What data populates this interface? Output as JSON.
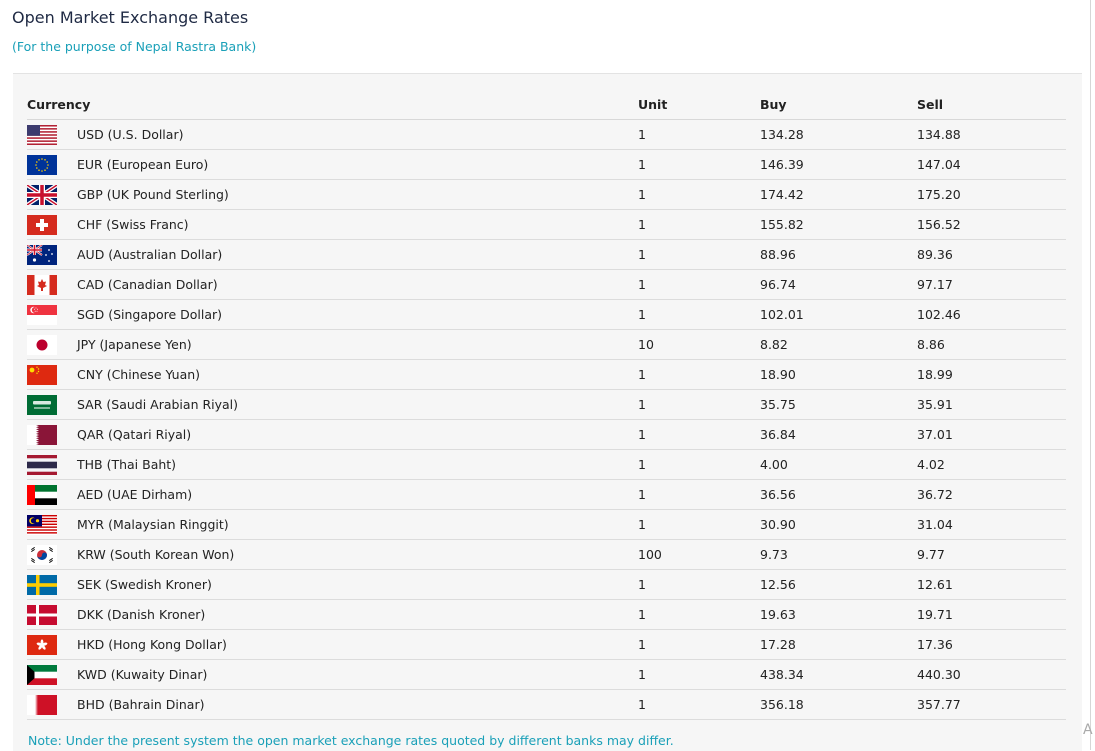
{
  "page": {
    "title": "Open Market Exchange Rates",
    "subtitle": "(For the purpose of Nepal Rastra Bank)",
    "note": "Note: Under the present system the open market exchange rates quoted by different banks may differ.",
    "edge_letter": "A"
  },
  "table": {
    "headers": {
      "currency": "Currency",
      "unit": "Unit",
      "buy": "Buy",
      "sell": "Sell"
    },
    "rows": [
      {
        "flag_icon": "flag-us-icon",
        "currency": "USD (U.S. Dollar)",
        "unit": "1",
        "buy": "134.28",
        "sell": "134.88"
      },
      {
        "flag_icon": "flag-eu-icon",
        "currency": "EUR (European Euro)",
        "unit": "1",
        "buy": "146.39",
        "sell": "147.04"
      },
      {
        "flag_icon": "flag-gb-icon",
        "currency": "GBP (UK Pound Sterling)",
        "unit": "1",
        "buy": "174.42",
        "sell": "175.20"
      },
      {
        "flag_icon": "flag-ch-icon",
        "currency": "CHF (Swiss Franc)",
        "unit": "1",
        "buy": "155.82",
        "sell": "156.52"
      },
      {
        "flag_icon": "flag-au-icon",
        "currency": "AUD (Australian Dollar)",
        "unit": "1",
        "buy": "88.96",
        "sell": "89.36"
      },
      {
        "flag_icon": "flag-ca-icon",
        "currency": "CAD (Canadian Dollar)",
        "unit": "1",
        "buy": "96.74",
        "sell": "97.17"
      },
      {
        "flag_icon": "flag-sg-icon",
        "currency": "SGD (Singapore Dollar)",
        "unit": "1",
        "buy": "102.01",
        "sell": "102.46"
      },
      {
        "flag_icon": "flag-jp-icon",
        "currency": "JPY (Japanese Yen)",
        "unit": "10",
        "buy": "8.82",
        "sell": "8.86"
      },
      {
        "flag_icon": "flag-cn-icon",
        "currency": "CNY (Chinese Yuan)",
        "unit": "1",
        "buy": "18.90",
        "sell": "18.99"
      },
      {
        "flag_icon": "flag-sa-icon",
        "currency": "SAR (Saudi Arabian Riyal)",
        "unit": "1",
        "buy": "35.75",
        "sell": "35.91"
      },
      {
        "flag_icon": "flag-qa-icon",
        "currency": "QAR (Qatari Riyal)",
        "unit": "1",
        "buy": "36.84",
        "sell": "37.01"
      },
      {
        "flag_icon": "flag-th-icon",
        "currency": "THB (Thai Baht)",
        "unit": "1",
        "buy": "4.00",
        "sell": "4.02"
      },
      {
        "flag_icon": "flag-ae-icon",
        "currency": "AED (UAE Dirham)",
        "unit": "1",
        "buy": "36.56",
        "sell": "36.72"
      },
      {
        "flag_icon": "flag-my-icon",
        "currency": "MYR (Malaysian Ringgit)",
        "unit": "1",
        "buy": "30.90",
        "sell": "31.04"
      },
      {
        "flag_icon": "flag-kr-icon",
        "currency": "KRW (South Korean Won)",
        "unit": "100",
        "buy": "9.73",
        "sell": "9.77"
      },
      {
        "flag_icon": "flag-se-icon",
        "currency": "SEK (Swedish Kroner)",
        "unit": "1",
        "buy": "12.56",
        "sell": "12.61"
      },
      {
        "flag_icon": "flag-dk-icon",
        "currency": "DKK (Danish Kroner)",
        "unit": "1",
        "buy": "19.63",
        "sell": "19.71"
      },
      {
        "flag_icon": "flag-hk-icon",
        "currency": "HKD (Hong Kong Dollar)",
        "unit": "1",
        "buy": "17.28",
        "sell": "17.36"
      },
      {
        "flag_icon": "flag-kw-icon",
        "currency": "KWD (Kuwaity Dinar)",
        "unit": "1",
        "buy": "438.34",
        "sell": "440.30"
      },
      {
        "flag_icon": "flag-bh-icon",
        "currency": "BHD (Bahrain Dinar)",
        "unit": "1",
        "buy": "356.18",
        "sell": "357.77"
      }
    ]
  },
  "colors": {
    "title": "#1f2a44",
    "accent": "#1aa0b8",
    "panel_background": "#f6f6f6",
    "row_divider": "#dcdcdc"
  }
}
